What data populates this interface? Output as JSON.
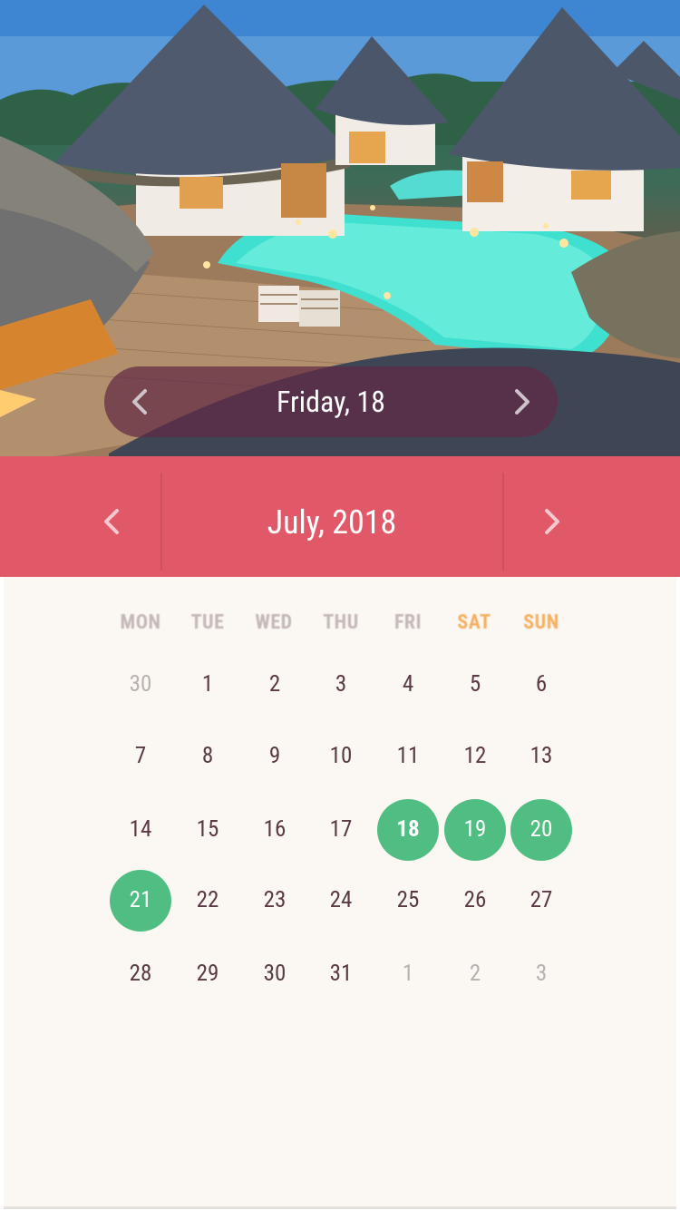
{
  "header": {
    "selected_date_label": "Friday, 18"
  },
  "month_bar": {
    "title": "July, 2018"
  },
  "calendar": {
    "weekdays": [
      {
        "label": "MON",
        "weekend": false
      },
      {
        "label": "TUE",
        "weekend": false
      },
      {
        "label": "WED",
        "weekend": false
      },
      {
        "label": "THU",
        "weekend": false
      },
      {
        "label": "FRI",
        "weekend": false
      },
      {
        "label": "SAT",
        "weekend": true
      },
      {
        "label": "SUN",
        "weekend": true
      }
    ],
    "weeks": [
      [
        {
          "d": "30",
          "m": true
        },
        {
          "d": "1"
        },
        {
          "d": "2"
        },
        {
          "d": "3"
        },
        {
          "d": "4"
        },
        {
          "d": "5"
        },
        {
          "d": "6"
        }
      ],
      [
        {
          "d": "7"
        },
        {
          "d": "8"
        },
        {
          "d": "9"
        },
        {
          "d": "10"
        },
        {
          "d": "11"
        },
        {
          "d": "12"
        },
        {
          "d": "13"
        }
      ],
      [
        {
          "d": "14"
        },
        {
          "d": "15"
        },
        {
          "d": "16"
        },
        {
          "d": "17"
        },
        {
          "d": "18",
          "s": true,
          "b": true
        },
        {
          "d": "19",
          "s": true
        },
        {
          "d": "20",
          "s": true
        }
      ],
      [
        {
          "d": "21",
          "s": true
        },
        {
          "d": "22"
        },
        {
          "d": "23"
        },
        {
          "d": "24"
        },
        {
          "d": "25"
        },
        {
          "d": "26"
        },
        {
          "d": "27"
        }
      ],
      [
        {
          "d": "28"
        },
        {
          "d": "29"
        },
        {
          "d": "30"
        },
        {
          "d": "31"
        },
        {
          "d": "1",
          "m": true
        },
        {
          "d": "2",
          "m": true
        },
        {
          "d": "3",
          "m": true
        }
      ]
    ]
  },
  "colors": {
    "accent": "#e15869",
    "selected": "#50be82",
    "weekend": "#f5b062",
    "pill": "#5f2a44"
  },
  "icons": {
    "prev": "chevron-left-icon",
    "next": "chevron-right-icon"
  }
}
